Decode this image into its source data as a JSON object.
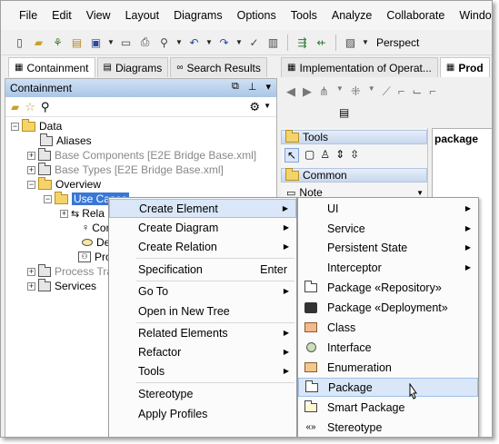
{
  "menubar": [
    "File",
    "Edit",
    "View",
    "Layout",
    "Diagrams",
    "Options",
    "Tools",
    "Analyze",
    "Collaborate",
    "Window"
  ],
  "toolbar": {
    "perspective_label": "Perspect"
  },
  "left_panel": {
    "tabs": [
      "Containment",
      "Diagrams",
      "Search Results"
    ],
    "title": "Containment",
    "tree": [
      {
        "label": "Data"
      },
      {
        "label": "Aliases"
      },
      {
        "label": "Base Components [E2E Bridge Base.xml]"
      },
      {
        "label": "Base Types [E2E Bridge Base.xml]"
      },
      {
        "label": "Overview"
      },
      {
        "label": "Use Cases"
      },
      {
        "label": "Rela"
      },
      {
        "label": "Con"
      },
      {
        "label": "Def"
      },
      {
        "label": "Pro"
      },
      {
        "label": "Process Tra"
      },
      {
        "label": "Services"
      }
    ]
  },
  "right_area": {
    "tabs": [
      "Implementation of Operat...",
      "Prod"
    ],
    "palette": {
      "tools_label": "Tools",
      "common_label": "Common",
      "note_label": "Note"
    },
    "canvas_label": "package"
  },
  "context_menu": {
    "items": [
      {
        "label": "Create Element"
      },
      {
        "label": "Create Diagram"
      },
      {
        "label": "Create Relation"
      },
      {
        "label": "Specification",
        "shortcut": "Enter"
      },
      {
        "label": "Go To"
      },
      {
        "label": "Open in New Tree"
      },
      {
        "label": "Related Elements"
      },
      {
        "label": "Refactor"
      },
      {
        "label": "Tools"
      },
      {
        "label": "Stereotype"
      },
      {
        "label": "Apply Profiles"
      }
    ]
  },
  "submenu": {
    "items": [
      {
        "label": "UI",
        "icon": "none"
      },
      {
        "label": "Service",
        "icon": "none"
      },
      {
        "label": "Persistent State",
        "icon": "none"
      },
      {
        "label": "Interceptor",
        "icon": "none"
      },
      {
        "label": "Package «Repository»",
        "icon": "package-icon"
      },
      {
        "label": "Package «Deployment»",
        "icon": "deployment-icon"
      },
      {
        "label": "Class",
        "icon": "class-icon"
      },
      {
        "label": "Interface",
        "icon": "interface-icon"
      },
      {
        "label": "Enumeration",
        "icon": "enumeration-icon"
      },
      {
        "label": "Package",
        "icon": "package-icon"
      },
      {
        "label": "Smart Package",
        "icon": "smart-package-icon"
      },
      {
        "label": "Stereotype",
        "icon": "stereotype-icon"
      }
    ]
  },
  "colors": {
    "selection": "#3a77d5",
    "menu_highlight": "#d9e7f8",
    "panel_header": "#aac6e6"
  }
}
